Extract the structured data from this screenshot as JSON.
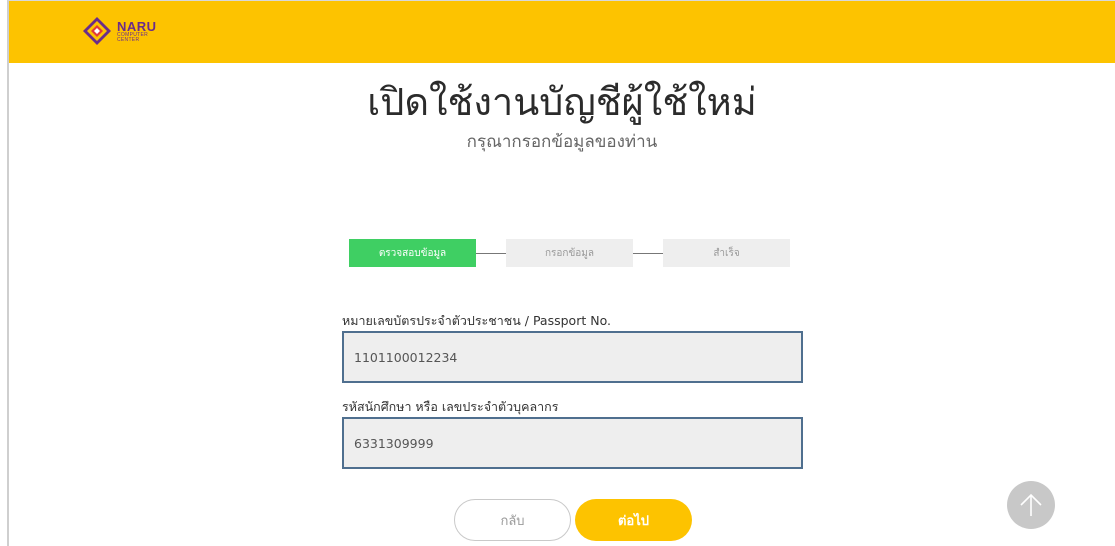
{
  "header": {
    "logo_line1": "NARU",
    "logo_line2": "COMPUTER",
    "logo_line3": "CENTER"
  },
  "page": {
    "title": "เปิดใช้งานบัญชีผู้ใช้ใหม่",
    "subtitle": "กรุณากรอกข้อมูลของท่าน"
  },
  "steps": [
    {
      "label": "ตรวจสอบข้อมูล",
      "state": "active"
    },
    {
      "label": "กรอกข้อมูล",
      "state": "inactive"
    },
    {
      "label": "สำเร็จ",
      "state": "inactive"
    }
  ],
  "form": {
    "id_label": "หมายเลขบัตรประจำตัวประชาชน / Passport No.",
    "id_value": "1101100012234",
    "student_label": "รหัสนักศึกษา หรือ เลขประจำตัวบุคลากร",
    "student_value": "6331309999"
  },
  "buttons": {
    "back": "กลับ",
    "next": "ต่อไป"
  },
  "icons": {
    "scroll_top": "arrow-up-icon"
  },
  "colors": {
    "brand_yellow": "#fdc300",
    "step_active": "#3fcf63",
    "input_border": "#4f6f8f"
  }
}
